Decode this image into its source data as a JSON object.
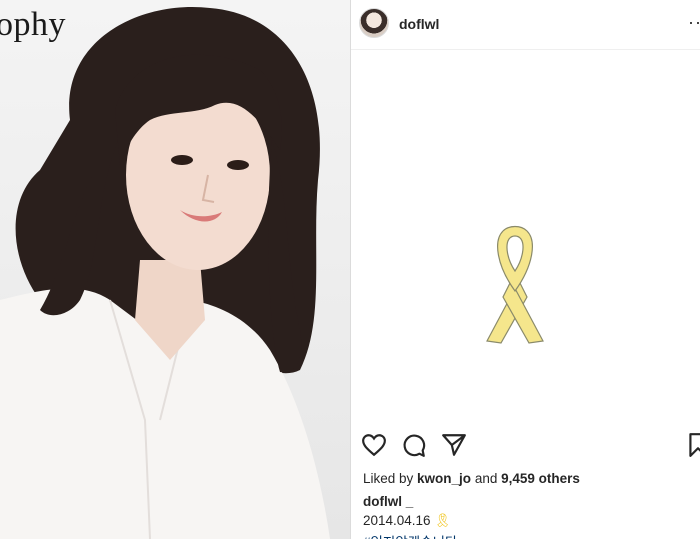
{
  "photo": {
    "brand_text": "ophy"
  },
  "post": {
    "username": "doflwl",
    "more_icon": "ellipsis-icon",
    "likes_prefix": "Liked by ",
    "liked_by_user": "kwon_jo",
    "likes_middle": " and ",
    "others_count": "9,459 others",
    "caption_username": "doflwl _",
    "caption_date": "2014.04.16",
    "caption_emoji": "🎗",
    "hashtag": "#잊지않겠습니다",
    "icons": [
      "heart-icon",
      "comment-icon",
      "share-icon",
      "bookmark-icon"
    ],
    "ribbon_color": "#f5e68c",
    "ribbon_outline": "#8a8a6a"
  }
}
